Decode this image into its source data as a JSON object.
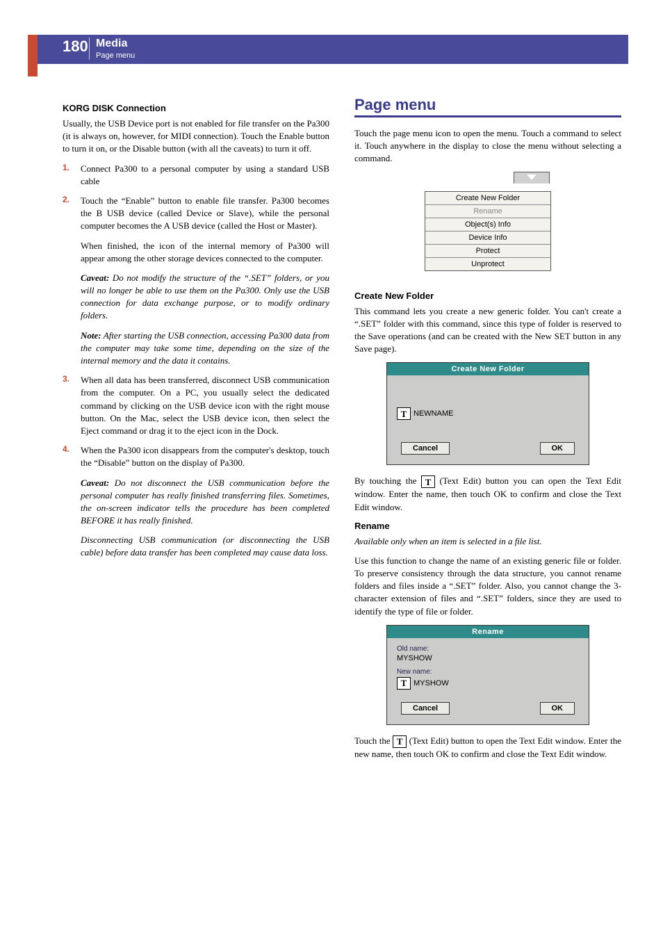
{
  "header": {
    "page_number": "180",
    "title": "Media",
    "subtitle": "Page menu"
  },
  "left": {
    "h_korg": "KORG DISK Connection",
    "p_usb_intro": "Usually, the USB Device port is not enabled for file transfer on the Pa300 (it is always on, however, for MIDI connection). Touch the Enable button to turn it on, or the Disable button (with all the caveats) to turn it off.",
    "step1": "Connect Pa300 to a personal computer by using a standard USB cable",
    "step2": "Touch the “Enable” button to enable file transfer. Pa300 becomes the B USB device (called Device or Slave), while the personal computer becomes the A USB device (called the Host or Master).",
    "step2_after": "When finished, the icon of the internal memory of Pa300 will appear among the other storage devices connected to the computer.",
    "caveat1_label": "Caveat:",
    "caveat1": " Do not modify the structure of the “.SET” folders, or you will no longer be able to use them on the Pa300. Only use the USB connection for data exchange purpose, or to modify ordinary folders.",
    "note1_label": "Note:",
    "note1": " After starting the USB connection, accessing Pa300 data from the computer may take some time, depending on the size of the internal memory and the data it contains.",
    "step3": "When all data has been transferred, disconnect USB communication from the computer. On a PC, you usually select the dedicated command by clicking on the USB device icon with the right mouse button. On the Mac, select the USB device icon, then select the Eject command or drag it to the eject icon in the Dock.",
    "step4": "When the Pa300 icon disappears from the computer's desktop, touch the “Disable” button on the display of Pa300.",
    "caveat2_label": "Caveat:",
    "caveat2": " Do not disconnect the USB communication before the personal computer has really finished transferring files. Sometimes, the on-screen indicator tells the procedure has been completed BEFORE it has really finished.",
    "discon": "Disconnecting USB communication (or disconnecting the USB cable) before data transfer has been completed may cause data loss."
  },
  "right": {
    "section_title": "Page menu",
    "intro": "Touch the page menu icon to open the menu. Touch a command to select it. Touch anywhere in the display to close the menu without selecting a command.",
    "menu_items": {
      "i0": "Create New Folder",
      "i1": "Rename",
      "i2": "Object(s) Info",
      "i3": "Device Info",
      "i4": "Protect",
      "i5": "Unprotect"
    },
    "h_cnf": "Create New Folder",
    "p_cnf": "This command lets you create a new generic folder. You can't create a “.SET” folder with this command, since this type of folder is reserved to the Save operations (and can be created with the New SET button in any Save page).",
    "dlg_cnf": {
      "title": "Create New Folder",
      "field_value": "NEWNAME",
      "btn_cancel": "Cancel",
      "btn_ok": "OK"
    },
    "p_textedit_a": "By touching the ",
    "p_textedit_b": " (Text Edit) button you can open the Text Edit window. Enter the name, then touch OK to confirm and close the Text Edit window.",
    "h_rename": "Rename",
    "p_rename_avail": "Available only when an item is selected in a file list.",
    "p_rename_body": "Use this function to change the name of an existing generic file or folder. To preserve consistency through the data structure, you cannot rename folders and files inside a “.SET” folder. Also, you cannot change the 3-character extension of files and “.SET” folders, since they are used to identify the type of file or folder.",
    "dlg_ren": {
      "title": "Rename",
      "old_label": "Old name:",
      "old_value": "MYSHOW",
      "new_label": "New name:",
      "new_value": "MYSHOW",
      "btn_cancel": "Cancel",
      "btn_ok": "OK"
    },
    "p_rename_after_a": "Touch the ",
    "p_rename_after_b": " (Text Edit) button to open the Text Edit window. Enter the new name, then touch OK to confirm and close the Text Edit window."
  },
  "t_glyph": "T"
}
